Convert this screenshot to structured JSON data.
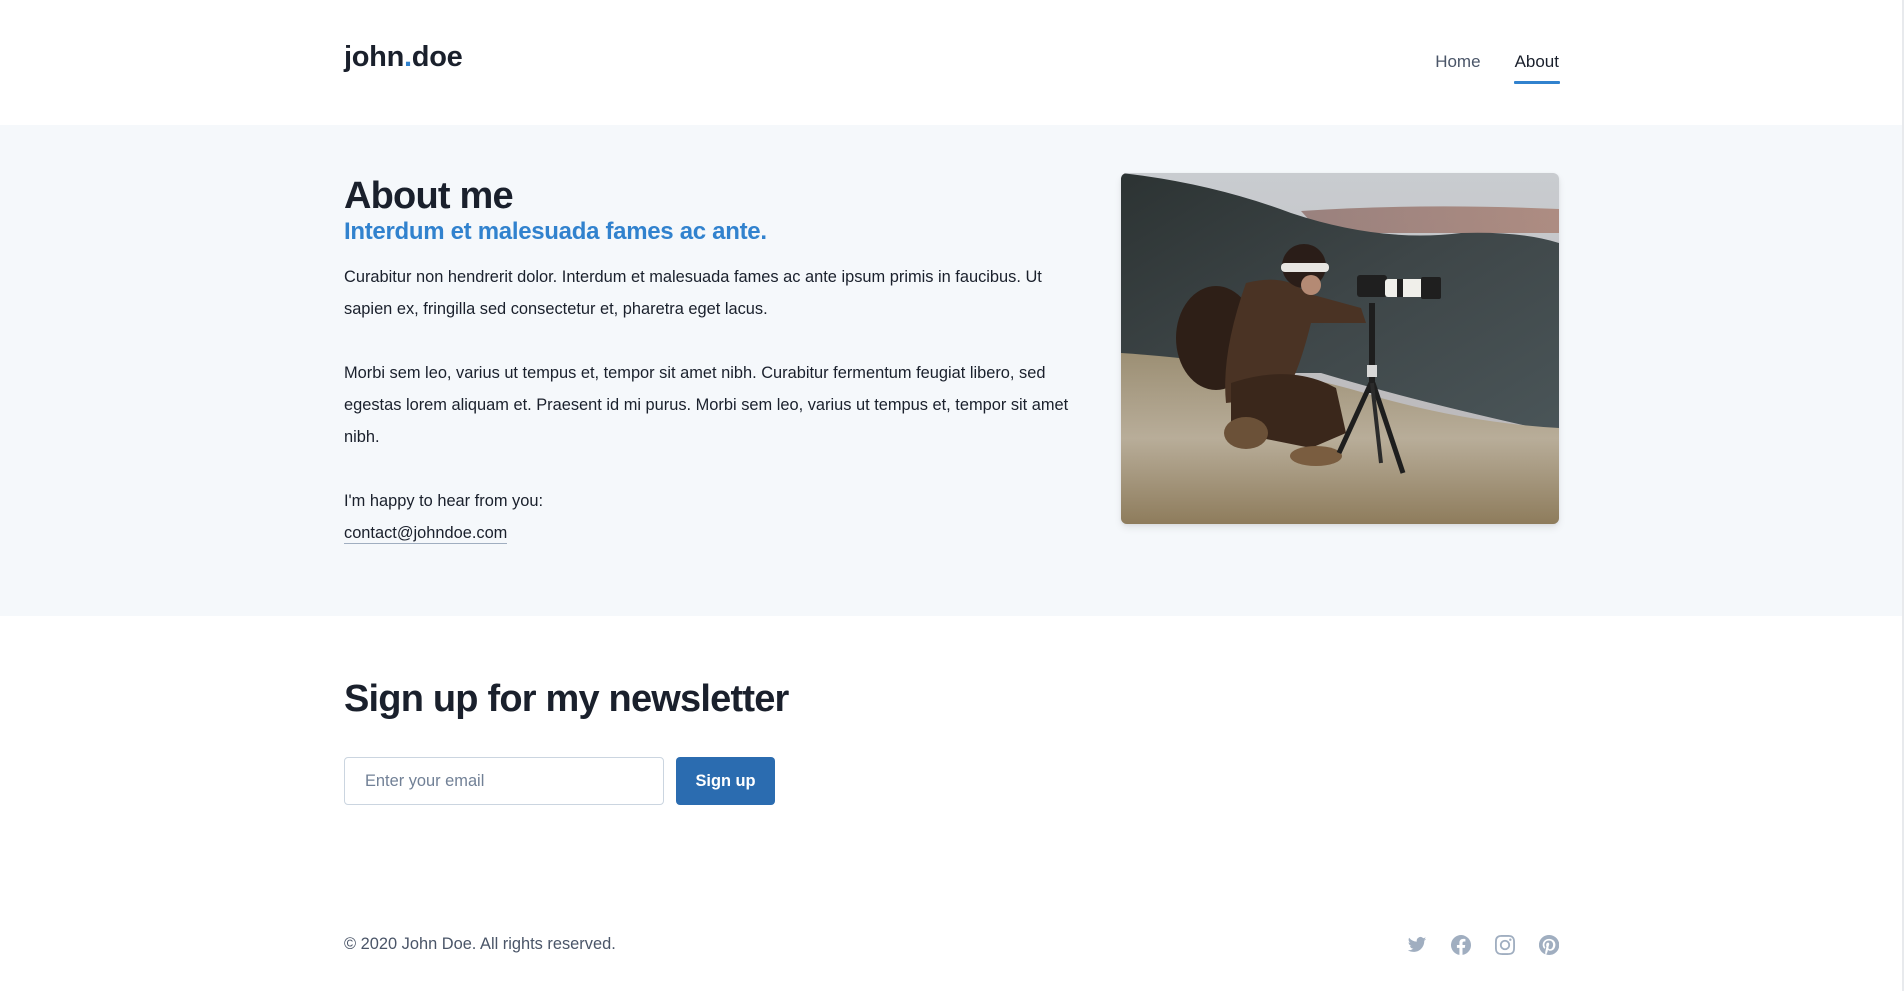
{
  "header": {
    "logo_first": "john",
    "logo_dot": ".",
    "logo_last": "doe",
    "nav": [
      {
        "label": "Home",
        "active": false
      },
      {
        "label": "About",
        "active": true
      }
    ]
  },
  "about": {
    "title": "About me",
    "subtitle": "Interdum et malesuada fames ac ante.",
    "paragraphs": [
      "Curabitur non hendrerit dolor. Interdum et malesuada fames ac ante ipsum primis in faucibus. Ut sapien ex, fringilla sed consectetur et, pharetra eget lacus.",
      "Morbi sem leo, varius ut tempus et, tempor sit amet nibh. Curabitur fermentum feugiat libero, sed egestas lorem aliquam et. Praesent id mi purus. Morbi sem leo, varius ut tempus et, tempor sit amet nibh."
    ],
    "contact_prompt": "I'm happy to hear from you:",
    "contact_email": "contact@johndoe.com",
    "photo_alt": "Photographer kneeling with a camera on a tripod on a frosty hillside"
  },
  "newsletter": {
    "title": "Sign up for my newsletter",
    "email_placeholder": "Enter your email",
    "email_value": "",
    "button_label": "Sign up"
  },
  "footer": {
    "copyright": "© 2020 John Doe. All rights reserved.",
    "socials": [
      "twitter-icon",
      "facebook-icon",
      "instagram-icon",
      "pinterest-icon"
    ]
  },
  "colors": {
    "accent": "#3182ce",
    "button": "#2b6cb0",
    "text": "#1a202c",
    "muted": "#4a5568",
    "icon": "#a0aec0",
    "section_bg": "#f5f8fb"
  }
}
